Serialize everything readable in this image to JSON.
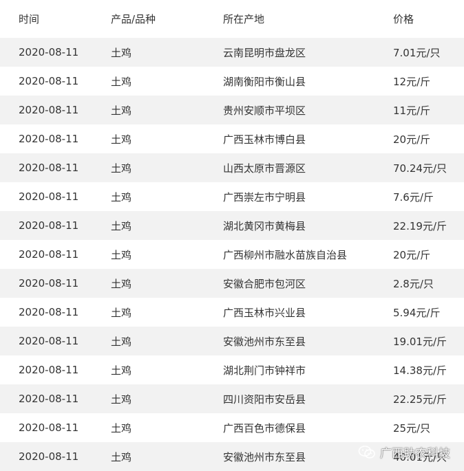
{
  "table": {
    "headers": [
      "时间",
      "产品/品种",
      "所在产地",
      "价格"
    ],
    "rows": [
      [
        "2020-08-11",
        "土鸡",
        "云南昆明市盘龙区",
        "7.01元/只"
      ],
      [
        "2020-08-11",
        "土鸡",
        "湖南衡阳市衡山县",
        "12元/斤"
      ],
      [
        "2020-08-11",
        "土鸡",
        "贵州安顺市平坝区",
        "11元/斤"
      ],
      [
        "2020-08-11",
        "土鸡",
        "广西玉林市博白县",
        "20元/斤"
      ],
      [
        "2020-08-11",
        "土鸡",
        "山西太原市晋源区",
        "70.24元/只"
      ],
      [
        "2020-08-11",
        "土鸡",
        "广西崇左市宁明县",
        "7.6元/斤"
      ],
      [
        "2020-08-11",
        "土鸡",
        "湖北黄冈市黄梅县",
        "22.19元/斤"
      ],
      [
        "2020-08-11",
        "土鸡",
        "广西柳州市融水苗族自治县",
        "20元/斤"
      ],
      [
        "2020-08-11",
        "土鸡",
        "安徽合肥市包河区",
        "2.8元/只"
      ],
      [
        "2020-08-11",
        "土鸡",
        "广西玉林市兴业县",
        "5.94元/斤"
      ],
      [
        "2020-08-11",
        "土鸡",
        "安徽池州市东至县",
        "19.01元/斤"
      ],
      [
        "2020-08-11",
        "土鸡",
        "湖北荆门市钟祥市",
        "14.38元/斤"
      ],
      [
        "2020-08-11",
        "土鸡",
        "四川资阳市安岳县",
        "22.25元/斤"
      ],
      [
        "2020-08-11",
        "土鸡",
        "广西百色市德保县",
        "25元/只"
      ],
      [
        "2020-08-11",
        "土鸡",
        "安徽池州市东至县",
        "40.01元/只"
      ]
    ]
  },
  "watermark": {
    "text": "广西助农科技",
    "icon": "wechat-icon"
  }
}
